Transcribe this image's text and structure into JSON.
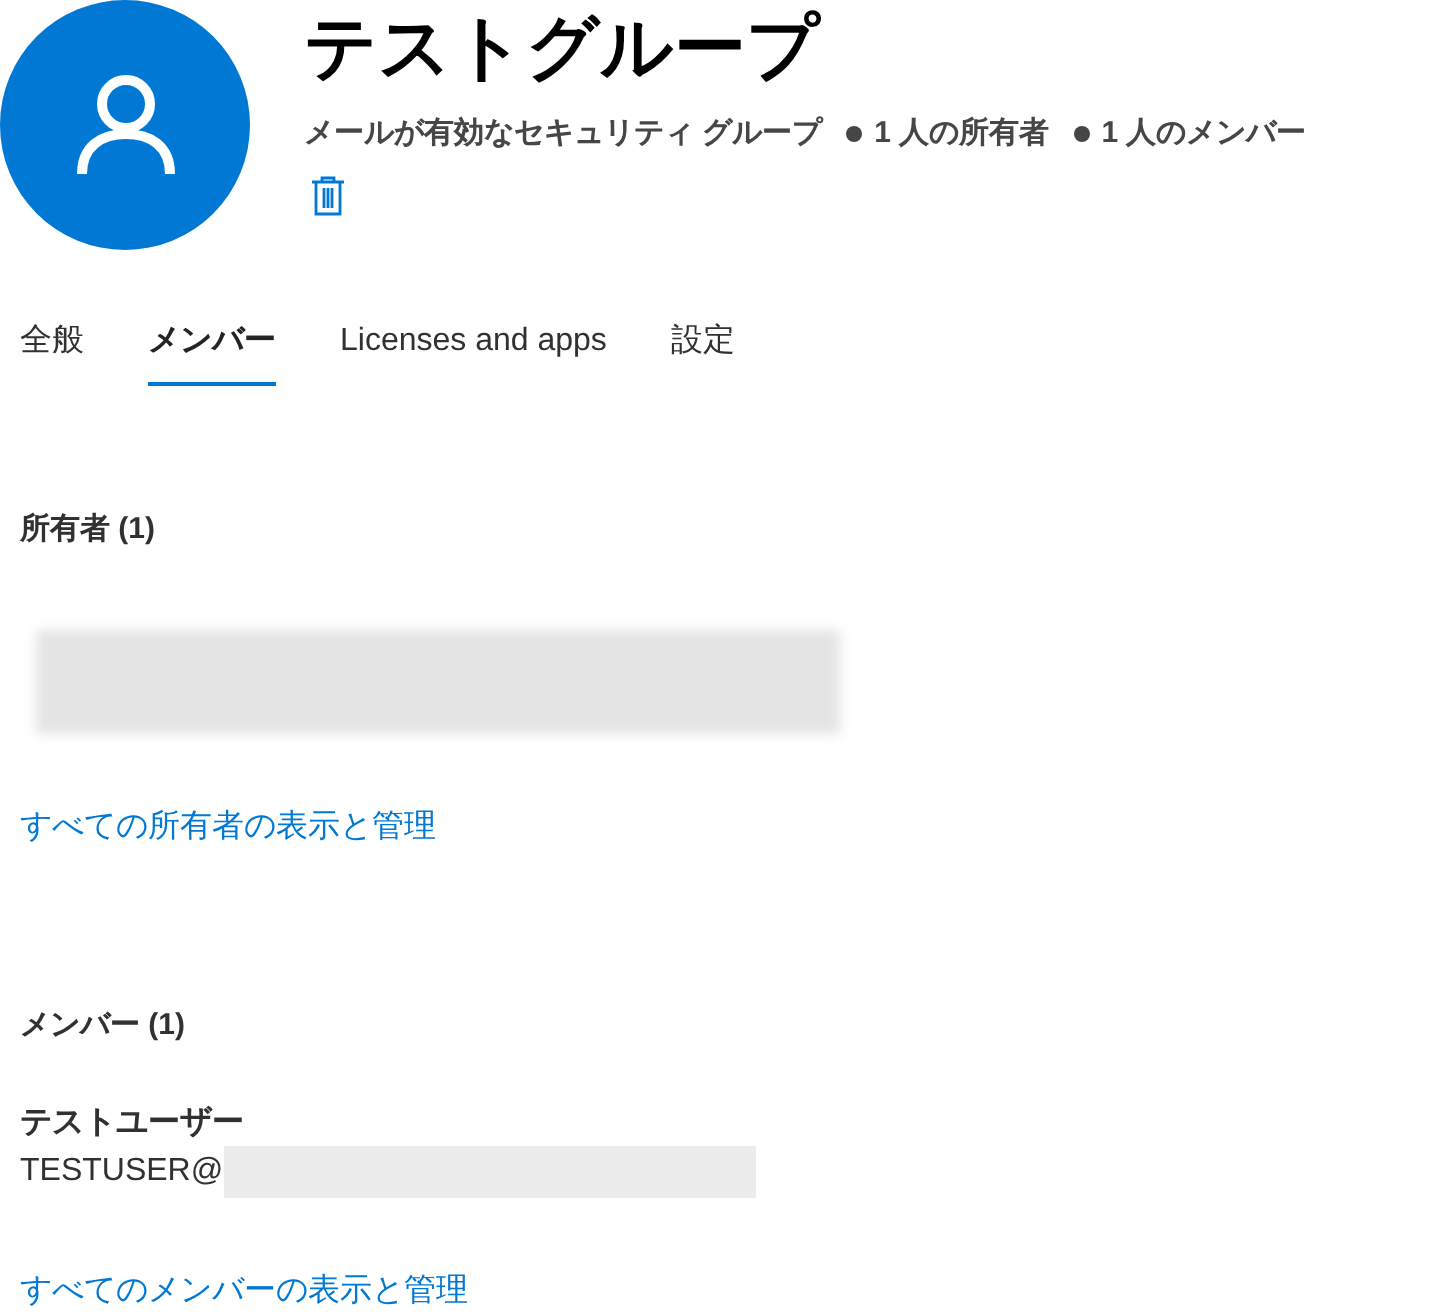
{
  "group": {
    "title": "テストグループ",
    "type": "メールが有効なセキュリティ グループ",
    "stats": [
      "1 人の所有者",
      "1 人のメンバー"
    ]
  },
  "tabs": [
    {
      "label": "全般",
      "selected": false
    },
    {
      "label": "メンバー",
      "selected": true
    },
    {
      "label": "Licenses and apps",
      "selected": false
    },
    {
      "label": "設定",
      "selected": false
    }
  ],
  "sections": [
    {
      "heading": "所有者 (1)",
      "entries": [
        {
          "kind": "redacted"
        }
      ],
      "link": "すべての所有者の表示と管理"
    },
    {
      "heading": "メンバー (1)",
      "entries": [
        {
          "kind": "user",
          "name": "テストユーザー",
          "email": "TESTUSER@"
        }
      ],
      "link": "すべてのメンバーの表示と管理"
    }
  ]
}
